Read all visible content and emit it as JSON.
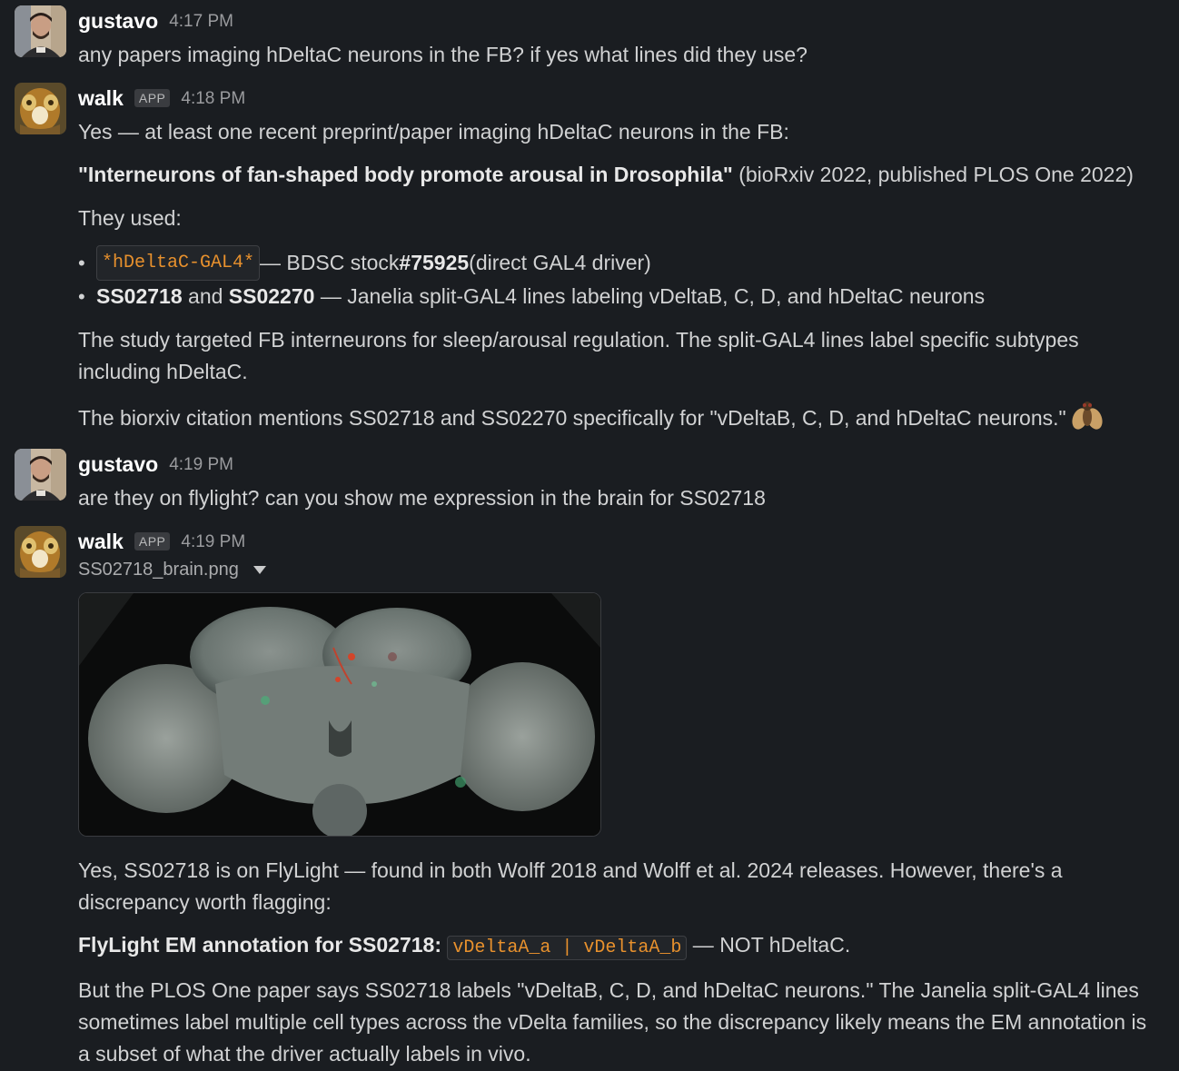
{
  "messages": [
    {
      "author": "gustavo",
      "time": "4:17 PM",
      "text": "any papers imaging hDeltaC neurons in the FB? if yes what lines did they use?"
    },
    {
      "author": "walk",
      "badge": "APP",
      "time": "4:18 PM",
      "intro": "Yes — at least one recent preprint/paper imaging hDeltaC neurons in the FB:",
      "paper_title": "\"Interneurons of fan-shaped body promote arousal in Drosophila\"",
      "paper_source": " (bioRxiv 2022, published PLOS One 2022)",
      "used": "They used:",
      "bullet1": {
        "code": "*hDeltaC-GAL4*",
        "pre": " — BDSC stock ",
        "stock": "#75925",
        "post": " (direct GAL4 driver)"
      },
      "bullet2": {
        "line1": "SS02718",
        "and": " and ",
        "line2": "SS02270",
        "rest": " — Janelia split-GAL4 lines labeling vDeltaB, C, D, and hDeltaC neurons"
      },
      "para1": "The study targeted FB interneurons for sleep/arousal regulation. The split-GAL4 lines label specific subtypes including hDeltaC.",
      "para2": "The biorxiv citation mentions SS02718 and SS02270 specifically for \"vDeltaB, C, D, and hDeltaC neurons.\"",
      "emoji": "fly-emoji"
    },
    {
      "author": "gustavo",
      "time": "4:19 PM",
      "text": "are they on flylight? can you show me expression in the brain for SS02718"
    },
    {
      "author": "walk",
      "badge": "APP",
      "time": "4:19 PM",
      "file_name": "SS02718_brain.png",
      "para1": "Yes, SS02718 is on FlyLight — found in both Wolff 2018 and Wolff et al. 2024 releases. However, there's a discrepancy worth flagging:",
      "annotation_label": "FlyLight EM annotation for SS02718:",
      "annotation_code": "vDeltaA_a | vDeltaA_b",
      "annotation_rest": " — NOT hDeltaC.",
      "para2": "But the PLOS One paper says SS02718 labels \"vDeltaB, C, D, and hDeltaC neurons.\" The Janelia split-GAL4 lines sometimes label multiple cell types across the vDelta families, so the discrepancy likely means the EM annotation is a subset of what the driver actually labels in vivo."
    }
  ],
  "colors": {
    "background": "#1a1d21",
    "text": "#d1d2d3",
    "code": "#e8912d"
  }
}
